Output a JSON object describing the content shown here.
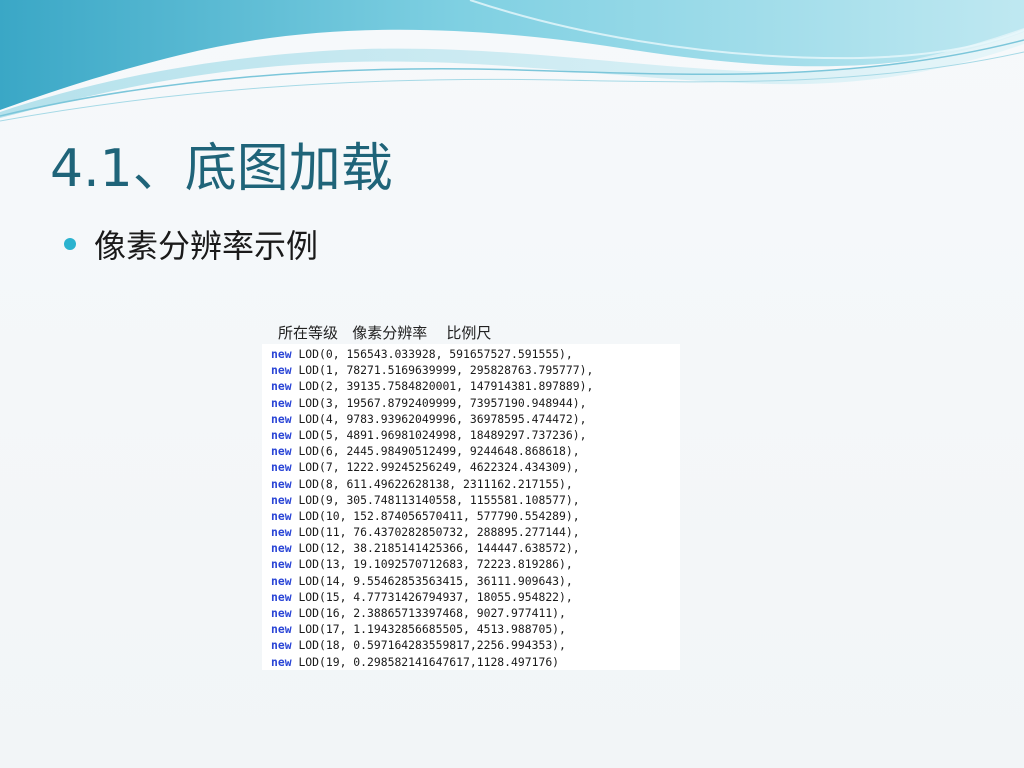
{
  "slide": {
    "title": "4.1、底图加载",
    "bullet": "像素分辨率示例",
    "caption": "所在等级   像素分辨率    比例尺",
    "code_keyword": "new",
    "code_lines": [
      "LOD(0, 156543.033928, 591657527.591555),",
      "LOD(1, 78271.5169639999, 295828763.795777),",
      "LOD(2, 39135.7584820001, 147914381.897889),",
      "LOD(3, 19567.8792409999, 73957190.948944),",
      "LOD(4, 9783.93962049996, 36978595.474472),",
      "LOD(5, 4891.96981024998, 18489297.737236),",
      "LOD(6, 2445.98490512499, 9244648.868618),",
      "LOD(7, 1222.99245256249, 4622324.434309),",
      "LOD(8, 611.49622628138, 2311162.217155),",
      "LOD(9, 305.748113140558, 1155581.108577),",
      "LOD(10, 152.874056570411, 577790.554289),",
      "LOD(11, 76.4370282850732, 288895.277144),",
      "LOD(12, 38.2185141425366, 144447.638572),",
      "LOD(13, 19.1092570712683, 72223.819286),",
      "LOD(14, 9.55462853563415, 36111.909643),",
      "LOD(15, 4.77731426794937, 18055.954822),",
      "LOD(16, 2.38865713397468, 9027.977411),",
      "LOD(17, 1.19432856685505, 4513.988705),",
      "LOD(18, 0.597164283559817,2256.994353),",
      "LOD(19, 0.298582141647617,1128.497176)"
    ],
    "colors": {
      "title": "#1f6479",
      "bullet_dot": "#2bb3cf",
      "keyword": "#2a45d6"
    }
  }
}
